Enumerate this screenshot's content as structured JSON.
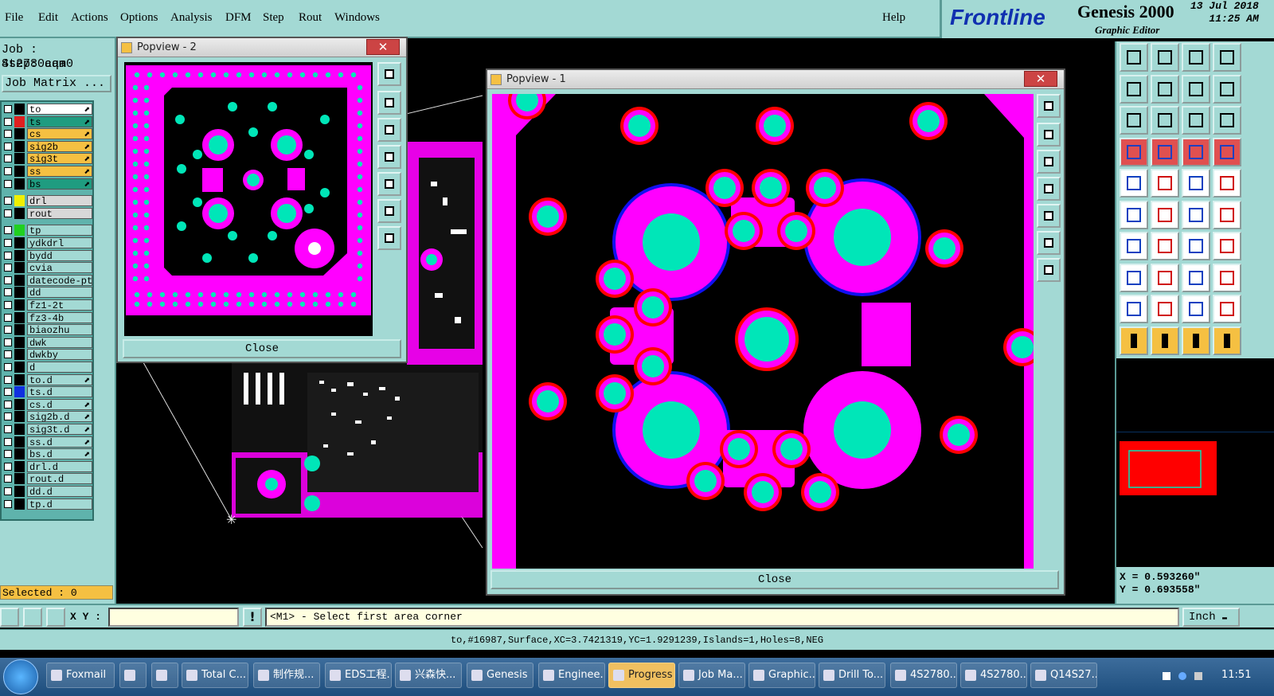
{
  "menubar": {
    "items": [
      "File",
      "Edit",
      "Actions",
      "Options",
      "Analysis",
      "DFM",
      "Step",
      "Rout",
      "Windows"
    ],
    "help": "Help"
  },
  "brand": {
    "logo": "Frontline",
    "product": "Genesis 2000",
    "subtitle": "Graphic Editor",
    "date": "13 Jul 2018",
    "time": "11:25 AM"
  },
  "job": {
    "job_line": "Job : 4s2780aqa0",
    "step_line": "Step: cam",
    "matrix_button": "Job Matrix ..."
  },
  "layers": [
    {
      "name": "to",
      "color": "#000000",
      "bg": "#ffffff",
      "mark": "⬈"
    },
    {
      "name": "ts",
      "color": "#e02020",
      "bg": "#1f9c80",
      "mark": "⬈"
    },
    {
      "name": "cs",
      "color": "#000000",
      "bg": "#f5c042",
      "mark": "⬈"
    },
    {
      "name": "sig2b",
      "color": "#000000",
      "bg": "#f5c042",
      "mark": "⬈"
    },
    {
      "name": "sig3t",
      "color": "#000000",
      "bg": "#f5c042",
      "mark": "⬈"
    },
    {
      "name": "ss",
      "color": "#000000",
      "bg": "#f5c042",
      "mark": "⬈"
    },
    {
      "name": "bs",
      "color": "#000000",
      "bg": "#1f9c80",
      "mark": "⬈"
    },
    {
      "name": "drl",
      "color": "#f0f000",
      "bg": "#d8d8d8",
      "mark": ""
    },
    {
      "name": "rout",
      "color": "#000000",
      "bg": "#d8d8d8",
      "mark": ""
    },
    {
      "name": "tp",
      "color": "#20d020",
      "bg": "#a3d9d4",
      "mark": ""
    },
    {
      "name": "ydkdrl",
      "color": "#000000",
      "bg": "#a3d9d4",
      "mark": ""
    },
    {
      "name": "bydd",
      "color": "#000000",
      "bg": "#a3d9d4",
      "mark": ""
    },
    {
      "name": "cvia",
      "color": "#000000",
      "bg": "#a3d9d4",
      "mark": ""
    },
    {
      "name": "datecode-pt",
      "color": "#000000",
      "bg": "#a3d9d4",
      "mark": ""
    },
    {
      "name": "dd",
      "color": "#000000",
      "bg": "#a3d9d4",
      "mark": ""
    },
    {
      "name": "fz1-2t",
      "color": "#000000",
      "bg": "#a3d9d4",
      "mark": ""
    },
    {
      "name": "fz3-4b",
      "color": "#000000",
      "bg": "#a3d9d4",
      "mark": ""
    },
    {
      "name": "biaozhu",
      "color": "#000000",
      "bg": "#a3d9d4",
      "mark": ""
    },
    {
      "name": "dwk",
      "color": "#000000",
      "bg": "#a3d9d4",
      "mark": ""
    },
    {
      "name": "dwkby",
      "color": "#000000",
      "bg": "#a3d9d4",
      "mark": ""
    },
    {
      "name": "d",
      "color": "#000000",
      "bg": "#a3d9d4",
      "mark": ""
    },
    {
      "name": "to.d",
      "color": "#000000",
      "bg": "#a3d9d4",
      "mark": "⬈"
    },
    {
      "name": "ts.d",
      "color": "#1030e0",
      "bg": "#a3d9d4",
      "mark": ""
    },
    {
      "name": "cs.d",
      "color": "#000000",
      "bg": "#a3d9d4",
      "mark": "⬈"
    },
    {
      "name": "sig2b.d",
      "color": "#000000",
      "bg": "#a3d9d4",
      "mark": "⬈"
    },
    {
      "name": "sig3t.d",
      "color": "#000000",
      "bg": "#a3d9d4",
      "mark": "⬈"
    },
    {
      "name": "ss.d",
      "color": "#000000",
      "bg": "#a3d9d4",
      "mark": "⬈"
    },
    {
      "name": "bs.d",
      "color": "#000000",
      "bg": "#a3d9d4",
      "mark": "⬈"
    },
    {
      "name": "drl.d",
      "color": "#000000",
      "bg": "#a3d9d4",
      "mark": ""
    },
    {
      "name": "rout.d",
      "color": "#000000",
      "bg": "#a3d9d4",
      "mark": ""
    },
    {
      "name": "dd.d",
      "color": "#000000",
      "bg": "#a3d9d4",
      "mark": ""
    },
    {
      "name": "tp.d",
      "color": "#000000",
      "bg": "#a3d9d4",
      "mark": ""
    }
  ],
  "selected_label": "Selected : 0",
  "popview2": {
    "title": "Popview - 2",
    "close_label": "Close"
  },
  "popview1": {
    "title": "Popview - 1",
    "close_label": "Close"
  },
  "coords": {
    "x": "X = 0.593260\"",
    "y": "Y = 0.693558\""
  },
  "cmdbar": {
    "xy_label": "X Y :",
    "input_value": "",
    "excl": "!",
    "prompt": "<M1> - Select first area corner",
    "units": "Inch"
  },
  "status": "to,#16987,Surface,XC=3.7421319,YC=1.9291239,Islands=1,Holes=8,NEG",
  "colors": {
    "panel": "#a3d9d4",
    "magenta": "#ff00ff",
    "cyan": "#00e6b8",
    "red": "#ff0000",
    "blue": "#1010f0"
  },
  "taskbar": {
    "items": [
      "Foxmail",
      "",
      "",
      "Total C...",
      "制作规...",
      "EDS工程...",
      "兴森快...",
      "Genesis",
      "Enginee...",
      "Progress",
      "Job Ma...",
      "Graphic...",
      "Drill To...",
      "4S2780...",
      "4S2780...",
      "Q14S27..."
    ],
    "clock": "11:51"
  }
}
